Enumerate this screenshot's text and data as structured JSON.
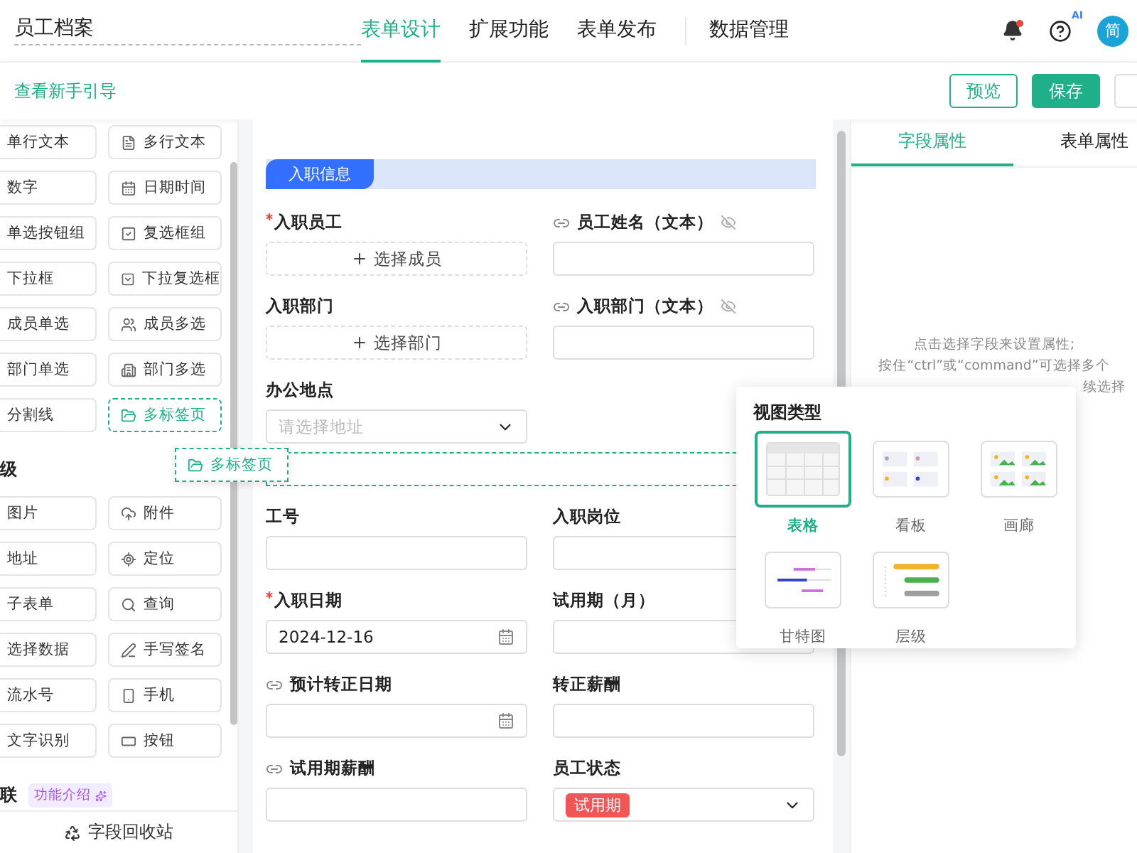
{
  "header": {
    "title": "员工档案",
    "tabs": [
      {
        "label": "表单设计",
        "selected": true
      },
      {
        "label": "扩展功能",
        "selected": false
      },
      {
        "label": "表单发布",
        "selected": false
      },
      {
        "label": "数据管理",
        "selected": false
      }
    ],
    "ai_badge": "AI",
    "avatar": "简",
    "notification": true
  },
  "toolbar": {
    "guide_link": "查看新手引导",
    "buttons": [
      {
        "label": "预览",
        "kind": "outline"
      },
      {
        "label": "保存",
        "kind": "primary"
      }
    ]
  },
  "sidebar": {
    "groups": [
      {
        "items": [
          {
            "label": "单行文本",
            "dragging": false
          },
          {
            "label": "多行文本",
            "dragging": false
          },
          {
            "label": "数字",
            "dragging": false
          },
          {
            "label": "日期时间",
            "dragging": false
          },
          {
            "label": "单选按钮组",
            "dragging": false
          },
          {
            "label": "复选框组",
            "dragging": false
          },
          {
            "label": "下拉框",
            "dragging": false
          },
          {
            "label": "下拉复选框",
            "dragging": false
          },
          {
            "label": "成员单选",
            "dragging": false
          },
          {
            "label": "成员多选",
            "dragging": false
          },
          {
            "label": "部门单选",
            "dragging": false
          },
          {
            "label": "部门多选",
            "dragging": false
          },
          {
            "label": "分割线",
            "dragging": false
          },
          {
            "label": "多标签页",
            "dragging": true
          }
        ]
      },
      {
        "title": "级",
        "items": [
          {
            "label": "图片",
            "dragging": false
          },
          {
            "label": "附件",
            "dragging": false
          },
          {
            "label": "地址",
            "dragging": false
          },
          {
            "label": "定位",
            "dragging": false
          },
          {
            "label": "子表单",
            "dragging": false
          },
          {
            "label": "查询",
            "dragging": false
          },
          {
            "label": "选择数据",
            "dragging": false
          },
          {
            "label": "手写签名",
            "dragging": false
          },
          {
            "label": "流水号",
            "dragging": false
          },
          {
            "label": "手机",
            "dragging": false
          },
          {
            "label": "文字识别",
            "dragging": false
          },
          {
            "label": "按钮",
            "dragging": false
          }
        ]
      },
      {
        "title": "联",
        "badge": "功能介绍"
      }
    ],
    "drag_ghost": "多标签页",
    "recycle": "字段回收站"
  },
  "form": {
    "section": "入职信息",
    "fields": [
      {
        "kind": "picker",
        "label": "入职员工",
        "required": true,
        "linked": false,
        "hidden": false,
        "value": "选择成员"
      },
      {
        "kind": "input",
        "label": "员工姓名（文本）",
        "required": false,
        "linked": true,
        "hidden": true
      },
      {
        "kind": "picker",
        "label": "入职部门",
        "required": false,
        "linked": false,
        "hidden": false,
        "value": "选择部门"
      },
      {
        "kind": "input",
        "label": "入职部门（文本）",
        "required": false,
        "linked": true,
        "hidden": true
      },
      {
        "kind": "select",
        "label": "办公地点",
        "required": false,
        "linked": false,
        "hidden": false,
        "placeholder": "请选择地址"
      },
      {
        "kind": "empty"
      },
      {
        "kind": "dropzone"
      },
      {
        "kind": "input",
        "label": "工号",
        "required": false,
        "linked": false,
        "hidden": false
      },
      {
        "kind": "input",
        "label": "入职岗位",
        "required": false,
        "linked": false,
        "hidden": false
      },
      {
        "kind": "date",
        "label": "入职日期",
        "required": true,
        "linked": false,
        "hidden": false,
        "value": "2024-12-16"
      },
      {
        "kind": "input",
        "label": "试用期（月）",
        "required": false,
        "linked": false,
        "hidden": false
      },
      {
        "kind": "date",
        "label": "预计转正日期",
        "required": false,
        "linked": true,
        "hidden": false
      },
      {
        "kind": "input",
        "label": "转正薪酬",
        "required": false,
        "linked": false,
        "hidden": false
      },
      {
        "kind": "input",
        "label": "试用期薪酬",
        "required": false,
        "linked": true,
        "hidden": false
      },
      {
        "kind": "tag",
        "label": "员工状态",
        "required": false,
        "linked": false,
        "hidden": false,
        "value": "试用期"
      }
    ]
  },
  "properties": {
    "tabs": [
      {
        "label": "字段属性",
        "selected": true
      },
      {
        "label": "表单属性",
        "selected": false
      }
    ],
    "hint": [
      "点击选择字段来设置属性;",
      "按住“ctrl”或“command”可选择多个",
      "续选择"
    ]
  },
  "view_popup": {
    "title": "视图类型",
    "options": [
      {
        "label": "表格",
        "kind": "table",
        "selected": true
      },
      {
        "label": "看板",
        "kind": "kanban",
        "selected": false
      },
      {
        "label": "画廊",
        "kind": "gallery",
        "selected": false
      },
      {
        "label": "甘特图",
        "kind": "gantt",
        "selected": false
      },
      {
        "label": "层级",
        "kind": "tree",
        "selected": false
      }
    ]
  }
}
